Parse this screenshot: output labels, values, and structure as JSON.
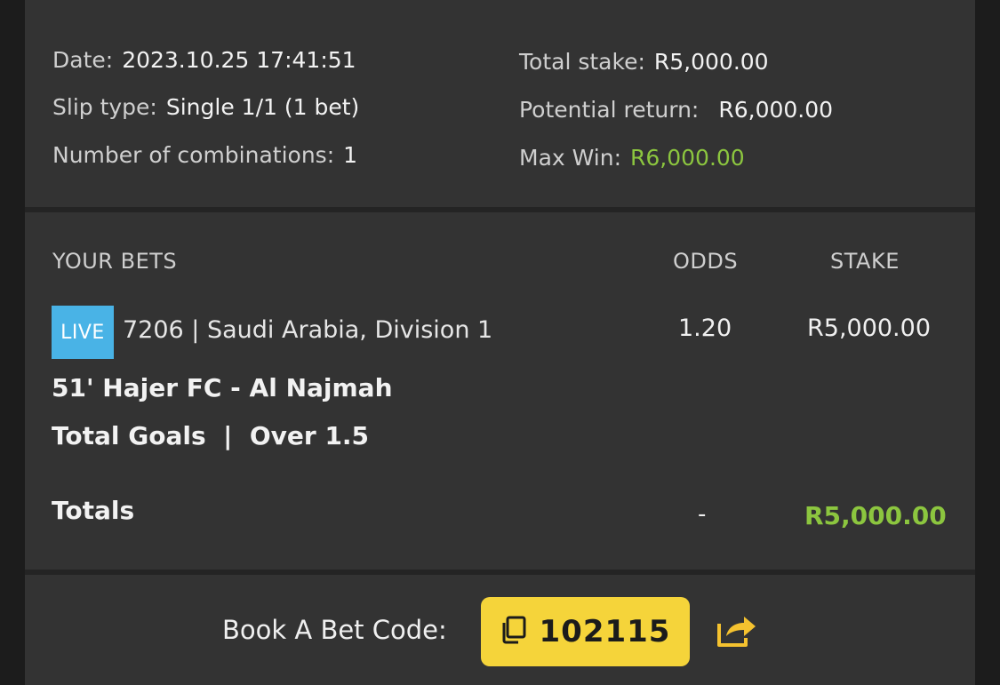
{
  "summary": {
    "date_label": "Date:",
    "date_value": "2023.10.25 17:41:51",
    "slip_type_label": "Slip type:",
    "slip_type_value": "Single 1/1 (1 bet)",
    "combinations_label": "Number of combinations:",
    "combinations_value": "1",
    "total_stake_label": "Total stake:",
    "total_stake_value": "R5,000.00",
    "potential_return_label": "Potential return:",
    "potential_return_value": "R6,000.00",
    "max_win_label": "Max Win:",
    "max_win_value": "R6,000.00"
  },
  "bets": {
    "headers": {
      "your_bets": "YOUR BETS",
      "odds": "ODDS",
      "stake": "STAKE"
    },
    "items": [
      {
        "badge": "LIVE",
        "event": "7206 | Saudi Arabia, Division 1",
        "match": "51' Hajer FC - Al Najmah",
        "market": "Total Goals  |  Over 1.5",
        "odds": "1.20",
        "stake": "R5,000.00"
      }
    ],
    "totals": {
      "label": "Totals",
      "odds": "-",
      "stake": "R5,000.00"
    }
  },
  "book_a_bet": {
    "label": "Book A Bet Code:",
    "code": "102115",
    "copy_icon": "copy-icon",
    "share_icon": "share-icon"
  },
  "colors": {
    "accent_green": "#8cc63f",
    "live_badge": "#49b3e6",
    "code_button": "#f5d43a",
    "panel_bg": "#333333"
  }
}
